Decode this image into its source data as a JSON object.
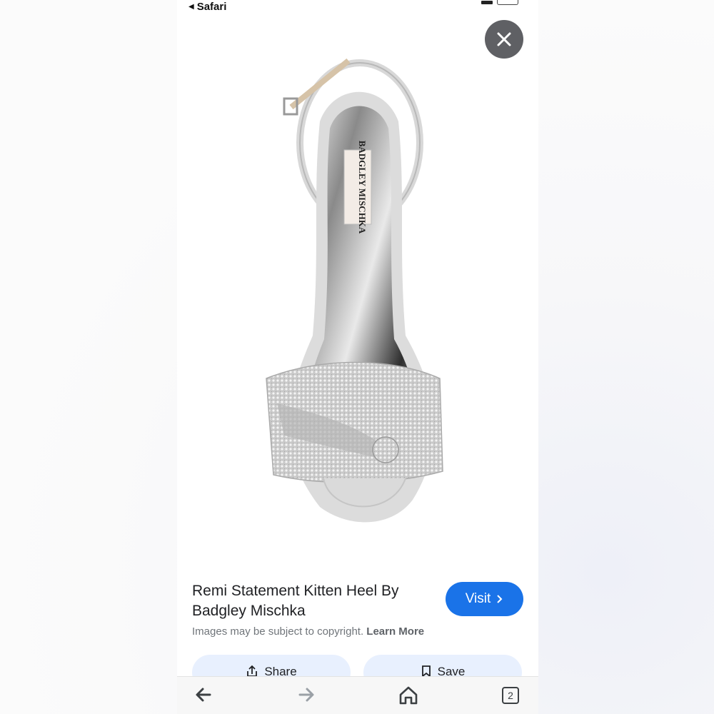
{
  "status_bar": {
    "back_app_label": "Safari"
  },
  "product": {
    "title": "Remi Statement Kitten Heel By Badgley Mischka",
    "visit_label": "Visit",
    "insole_brand": "BADGLEY MISCHKA"
  },
  "copyright": {
    "text": "Images may be subject to copyright.",
    "link": "Learn More"
  },
  "actions": {
    "share_label": "Share",
    "save_label": "Save"
  },
  "bottom_nav": {
    "tabs_count": "2"
  },
  "colors": {
    "accent": "#1a73e8",
    "action_bg": "#e8f0fe",
    "close_bg": "#5f6064"
  },
  "icons": [
    "close-icon",
    "chevron-right-icon",
    "share-icon",
    "bookmark-icon",
    "back-arrow-icon",
    "forward-arrow-icon",
    "home-icon",
    "tabs-icon"
  ]
}
